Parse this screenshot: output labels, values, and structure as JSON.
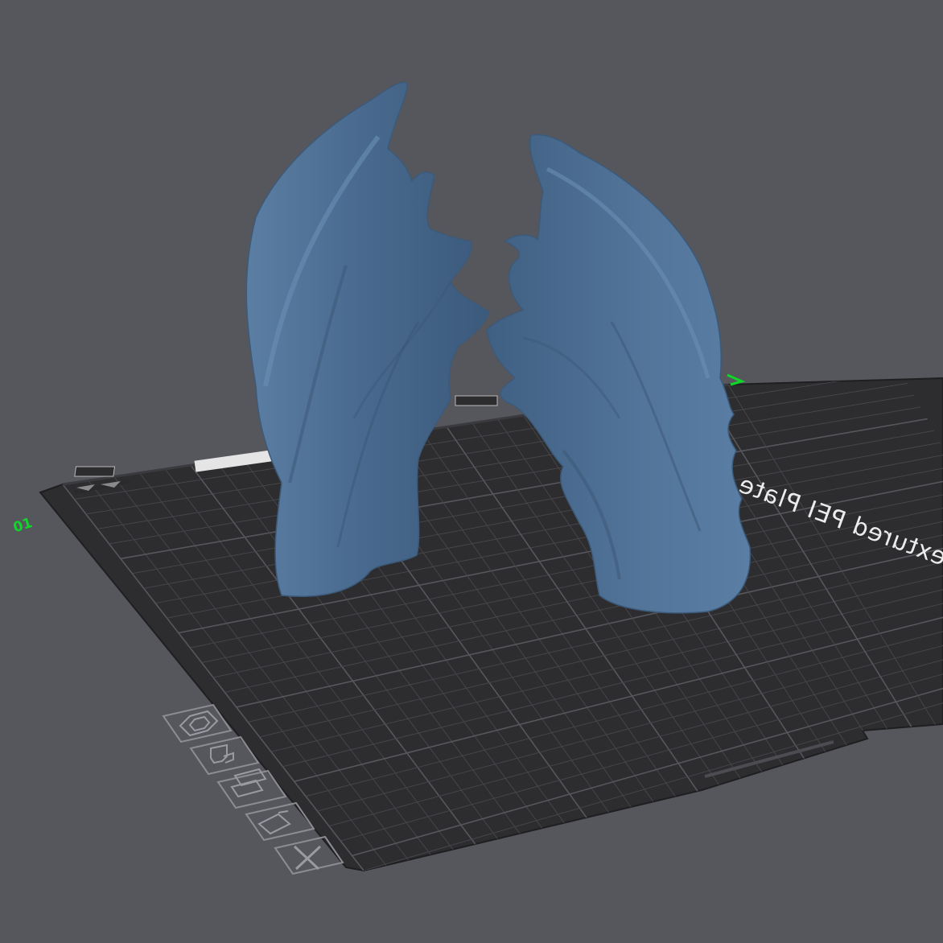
{
  "viewport": {
    "background": "#56565d",
    "plate": {
      "label": "Textured PEI Plate",
      "plate_index": "01",
      "surface_color": "#2d2d30",
      "grid_color": "#46464b",
      "axis_color": "#10d62a"
    },
    "model": {
      "color": "#4d6f93",
      "parts": [
        "left-wing",
        "right-wing"
      ]
    },
    "plate_toolbar": [
      {
        "id": "orient",
        "icon": "hexagon-icon"
      },
      {
        "id": "filament-settings",
        "icon": "nozzle-icon"
      },
      {
        "id": "arrange",
        "icon": "arrange-icon"
      },
      {
        "id": "lock-plate",
        "icon": "plate-lock-icon"
      },
      {
        "id": "delete-plate",
        "icon": "close-icon"
      }
    ]
  }
}
